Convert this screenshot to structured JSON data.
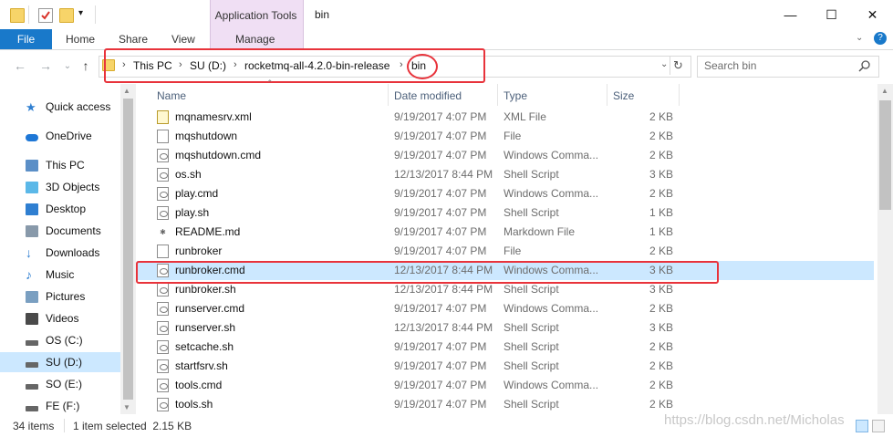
{
  "window": {
    "title": "bin",
    "context_tab": "Application Tools",
    "controls": {
      "minimize": "—",
      "maximize": "☐",
      "close": "✕"
    }
  },
  "ribbon": {
    "tabs": [
      {
        "label": "File"
      },
      {
        "label": "Home"
      },
      {
        "label": "Share"
      },
      {
        "label": "View"
      },
      {
        "label": "Manage"
      }
    ]
  },
  "address": {
    "crumbs": [
      {
        "label": "This PC"
      },
      {
        "label": "SU (D:)"
      },
      {
        "label": "rocketmq-all-4.2.0-bin-release"
      },
      {
        "label": "bin"
      }
    ],
    "separator": "›"
  },
  "search": {
    "placeholder": "Search bin"
  },
  "nav": {
    "items": [
      {
        "label": "Quick access",
        "icon": "star-icon"
      },
      {
        "label": "OneDrive",
        "icon": "cloud-icon"
      },
      {
        "label": "This PC",
        "icon": "computer-icon"
      },
      {
        "label": "3D Objects",
        "icon": "cube-icon"
      },
      {
        "label": "Desktop",
        "icon": "desktop-icon"
      },
      {
        "label": "Documents",
        "icon": "document-icon"
      },
      {
        "label": "Downloads",
        "icon": "download-icon"
      },
      {
        "label": "Music",
        "icon": "music-icon"
      },
      {
        "label": "Pictures",
        "icon": "pictures-icon"
      },
      {
        "label": "Videos",
        "icon": "video-icon"
      },
      {
        "label": "OS (C:)",
        "icon": "drive-icon"
      },
      {
        "label": "SU (D:)",
        "icon": "drive-icon",
        "selected": true
      },
      {
        "label": "SO (E:)",
        "icon": "drive-icon"
      },
      {
        "label": "FE (F:)",
        "icon": "drive-icon"
      }
    ]
  },
  "columns": {
    "name": "Name",
    "date": "Date modified",
    "type": "Type",
    "size": "Size"
  },
  "files": [
    {
      "name": "mqnamesrv.xml",
      "date": "9/19/2017 4:07 PM",
      "type": "XML File",
      "size": "2 KB",
      "icon": "xml"
    },
    {
      "name": "mqshutdown",
      "date": "9/19/2017 4:07 PM",
      "type": "File",
      "size": "2 KB",
      "icon": "file"
    },
    {
      "name": "mqshutdown.cmd",
      "date": "9/19/2017 4:07 PM",
      "type": "Windows Comma...",
      "size": "2 KB",
      "icon": "cmd"
    },
    {
      "name": "os.sh",
      "date": "12/13/2017 8:44 PM",
      "type": "Shell Script",
      "size": "3 KB",
      "icon": "cmd"
    },
    {
      "name": "play.cmd",
      "date": "9/19/2017 4:07 PM",
      "type": "Windows Comma...",
      "size": "2 KB",
      "icon": "cmd"
    },
    {
      "name": "play.sh",
      "date": "9/19/2017 4:07 PM",
      "type": "Shell Script",
      "size": "1 KB",
      "icon": "cmd"
    },
    {
      "name": "README.md",
      "date": "9/19/2017 4:07 PM",
      "type": "Markdown File",
      "size": "1 KB",
      "icon": "md"
    },
    {
      "name": "runbroker",
      "date": "9/19/2017 4:07 PM",
      "type": "File",
      "size": "2 KB",
      "icon": "file"
    },
    {
      "name": "runbroker.cmd",
      "date": "12/13/2017 8:44 PM",
      "type": "Windows Comma...",
      "size": "3 KB",
      "icon": "cmd",
      "selected": true
    },
    {
      "name": "runbroker.sh",
      "date": "12/13/2017 8:44 PM",
      "type": "Shell Script",
      "size": "3 KB",
      "icon": "cmd"
    },
    {
      "name": "runserver.cmd",
      "date": "9/19/2017 4:07 PM",
      "type": "Windows Comma...",
      "size": "2 KB",
      "icon": "cmd"
    },
    {
      "name": "runserver.sh",
      "date": "12/13/2017 8:44 PM",
      "type": "Shell Script",
      "size": "3 KB",
      "icon": "cmd"
    },
    {
      "name": "setcache.sh",
      "date": "9/19/2017 4:07 PM",
      "type": "Shell Script",
      "size": "2 KB",
      "icon": "cmd"
    },
    {
      "name": "startfsrv.sh",
      "date": "9/19/2017 4:07 PM",
      "type": "Shell Script",
      "size": "2 KB",
      "icon": "cmd"
    },
    {
      "name": "tools.cmd",
      "date": "9/19/2017 4:07 PM",
      "type": "Windows Comma...",
      "size": "2 KB",
      "icon": "cmd"
    },
    {
      "name": "tools.sh",
      "date": "9/19/2017 4:07 PM",
      "type": "Shell Script",
      "size": "2 KB",
      "icon": "cmd"
    }
  ],
  "status": {
    "item_count": "34 items",
    "selection": "1 item selected  2.15 KB"
  },
  "watermark": "https://blog.csdn.net/Micholas",
  "colors": {
    "accent": "#1979ca",
    "context_tab": "#f0dff4",
    "selection": "#cce8ff",
    "annotation": "#e8333b"
  }
}
